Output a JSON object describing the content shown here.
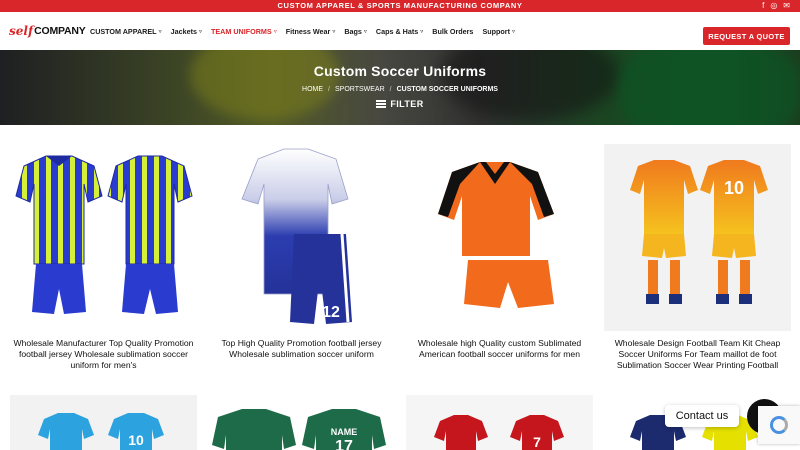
{
  "topbar": {
    "promo": "CUSTOM APPAREL & SPORTS MANUFACTURING COMPANY",
    "socials": [
      "facebook-icon",
      "instagram-icon",
      "email-icon"
    ]
  },
  "logo": {
    "self": "self",
    "company": "COMPANY"
  },
  "nav": [
    {
      "label": "CUSTOM APPAREL",
      "chevron": true,
      "active": false
    },
    {
      "label": "Jackets",
      "chevron": true,
      "active": false
    },
    {
      "label": "TEAM UNIFORMS",
      "chevron": true,
      "active": true
    },
    {
      "label": "Fitness Wear",
      "chevron": true,
      "active": false
    },
    {
      "label": "Bags",
      "chevron": true,
      "active": false
    },
    {
      "label": "Caps & Hats",
      "chevron": true,
      "active": false
    },
    {
      "label": "Bulk Orders",
      "chevron": false,
      "active": false
    },
    {
      "label": "Support",
      "chevron": true,
      "active": false
    }
  ],
  "quote_button": "REQUEST A QUOTE",
  "hero": {
    "title": "Custom Soccer Uniforms",
    "breadcrumb": [
      "HOME",
      "SPORTSWEAR",
      "CUSTOM SOCCER UNIFORMS"
    ],
    "filter_label": "FILTER"
  },
  "products": [
    {
      "caption": "Wholesale Manufacturer Top Quality Promotion football jersey Wholesale sublimation soccer uniform for men's"
    },
    {
      "caption": "Top High Quality Promotion football jersey Wholesale sublimation soccer uniform"
    },
    {
      "caption": "Wholesale high Quality custom Sublimated American football soccer uniforms for men"
    },
    {
      "caption": "Wholesale Design Football Team Kit Cheap Soccer Uniforms For Team maillot de foot Sublimation Soccer Wear Printing Football"
    }
  ],
  "jersey_prints": {
    "p2_number": "12",
    "p4_number": "10",
    "r2_1_number": "10",
    "r2_2_name": "NAME",
    "r2_2_number": "17",
    "r2_3_number": "7"
  },
  "contact_label": "Contact us",
  "colors": {
    "brand_red": "#d9262b"
  }
}
